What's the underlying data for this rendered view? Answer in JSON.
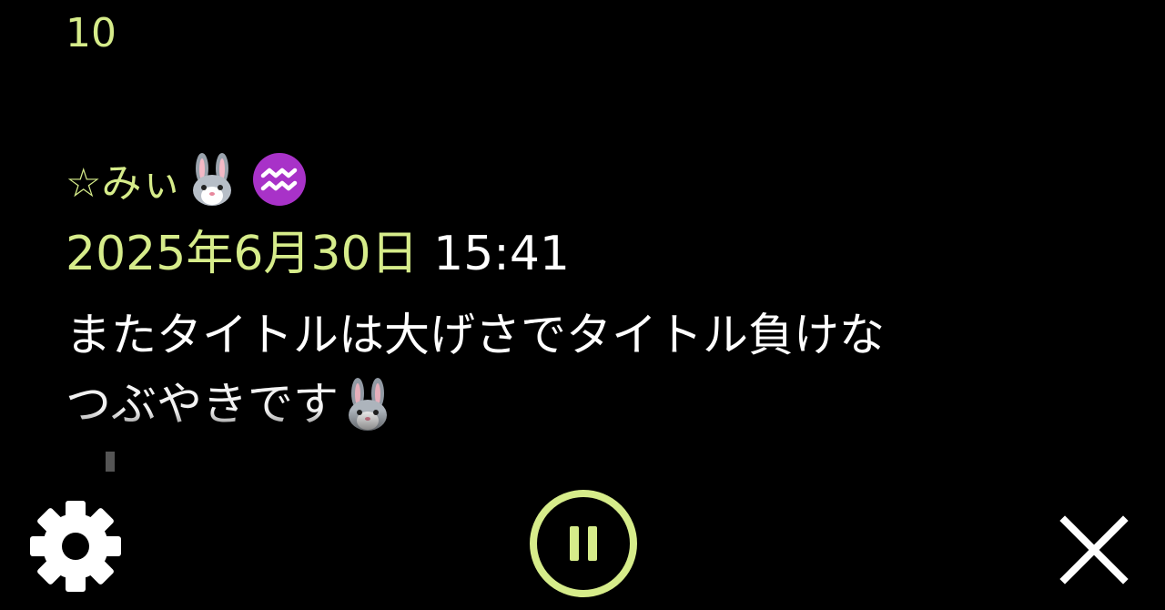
{
  "stream": {
    "count": "10"
  },
  "post": {
    "author": "☆みぃ",
    "author_icons": [
      "rabbit-face-emoji",
      "aquarius-emoji"
    ],
    "timestamp_date": "2025年6月30日",
    "timestamp_time": "15:41",
    "body_line_1": "またタイトルは大げさでタイトル負けな",
    "body_line_2": "つぶやきです",
    "body_icon": "rabbit-face-emoji"
  },
  "controls": {
    "settings_icon": "gear-icon",
    "pause_icon": "pause-icon",
    "close_icon": "close-icon"
  },
  "colors": {
    "background": "#000000",
    "accent": "#d6ec8a",
    "text": "#ffffff",
    "aquarius": "#a832c8"
  }
}
